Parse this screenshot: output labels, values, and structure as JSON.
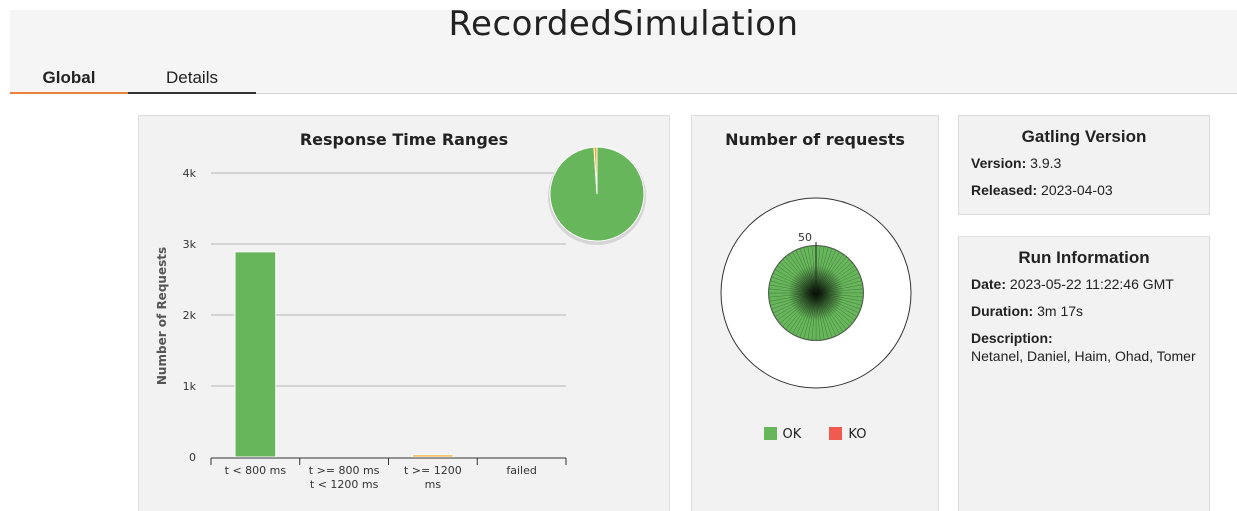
{
  "page": {
    "title": "RecordedSimulation"
  },
  "tabs": [
    {
      "label": "Global"
    },
    {
      "label": "Details"
    }
  ],
  "response_time": {
    "title": "Response Time Ranges",
    "ylabel": "Number of Requests",
    "yticks": [
      "0",
      "1k",
      "2k",
      "3k",
      "4k"
    ]
  },
  "requests": {
    "title": "Number of requests",
    "scale_label": "50",
    "legend": [
      {
        "label": "OK",
        "color": "#68b65c"
      },
      {
        "label": "KO",
        "color": "#f15b4f"
      }
    ]
  },
  "gatling": {
    "title": "Gatling Version",
    "version_key": "Version:",
    "version": "3.9.3",
    "released_key": "Released:",
    "released": "2023-04-03"
  },
  "run": {
    "title": "Run Information",
    "date_key": "Date:",
    "date": "2023-05-22 11:22:46 GMT",
    "duration_key": "Duration:",
    "duration": "3m 17s",
    "description_key": "Description:",
    "description": "Netanel, Daniel, Haim, Ohad, Tomer"
  },
  "chart_data": [
    {
      "type": "bar",
      "title": "Response Time Ranges",
      "ylabel": "Number of Requests",
      "ylim": [
        0,
        4000
      ],
      "grid": true,
      "categories": [
        "t < 800 ms",
        "t >= 800 ms t < 1200 ms",
        "t >= 1200 ms",
        "failed"
      ],
      "category_lines": [
        [
          "t < 800 ms"
        ],
        [
          "t >= 800 ms",
          "t < 1200 ms"
        ],
        [
          "t >= 1200",
          "ms"
        ],
        [
          "failed"
        ]
      ],
      "values": [
        2890,
        0,
        30,
        0
      ],
      "colors": [
        "#68b65c",
        "#ffdd00",
        "#f5a623",
        "#f15b4f"
      ]
    },
    {
      "type": "pie",
      "values": [
        2890,
        0,
        30,
        0
      ],
      "colors": [
        "#68b65c",
        "#ffdd00",
        "#f5a623",
        "#f15b4f"
      ]
    }
  ]
}
